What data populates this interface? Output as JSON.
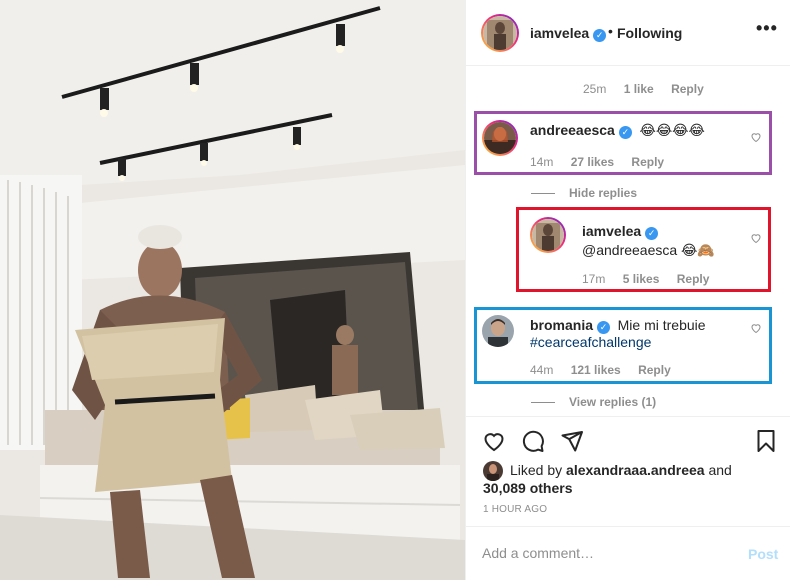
{
  "header": {
    "username": "iamvelea",
    "separator": "•",
    "follow_state": "Following",
    "more_icon": "more-horizontal-icon"
  },
  "top_comment_meta": {
    "time": "25m",
    "likes": "1 like",
    "reply": "Reply"
  },
  "comments": [
    {
      "username": "andreeaesca",
      "verified": true,
      "text": "😂😂😂😂",
      "time": "14m",
      "likes": "27 likes",
      "reply": "Reply"
    },
    {
      "username": "iamvelea",
      "verified": true,
      "text": "@andreeaesca 😂🙈",
      "time": "17m",
      "likes": "5 likes",
      "reply": "Reply"
    },
    {
      "username": "bromania",
      "verified": true,
      "text_line1": "Mie mi trebuie",
      "text_line2": "#cearceafchallenge",
      "time": "44m",
      "likes": "121 likes",
      "reply": "Reply"
    }
  ],
  "hide_replies": "Hide replies",
  "view_replies": "View replies (1)",
  "actions": {
    "like_icon": "heart-icon",
    "comment_icon": "comment-icon",
    "share_icon": "send-icon",
    "save_icon": "bookmark-icon"
  },
  "likes_summary": {
    "prefix": "Liked by",
    "user": "alexandraaa.andreea",
    "conj": "and",
    "others": "30,089 others"
  },
  "time_ago": "1 HOUR AGO",
  "add_comment": {
    "placeholder": "Add a comment…",
    "post_label": "Post"
  },
  "colors": {
    "highlight_purple": "#9b4fa8",
    "highlight_red": "#e0142a",
    "highlight_blue": "#1a95d3",
    "verified": "#3897f0",
    "post_disabled": "#b2dffc"
  }
}
